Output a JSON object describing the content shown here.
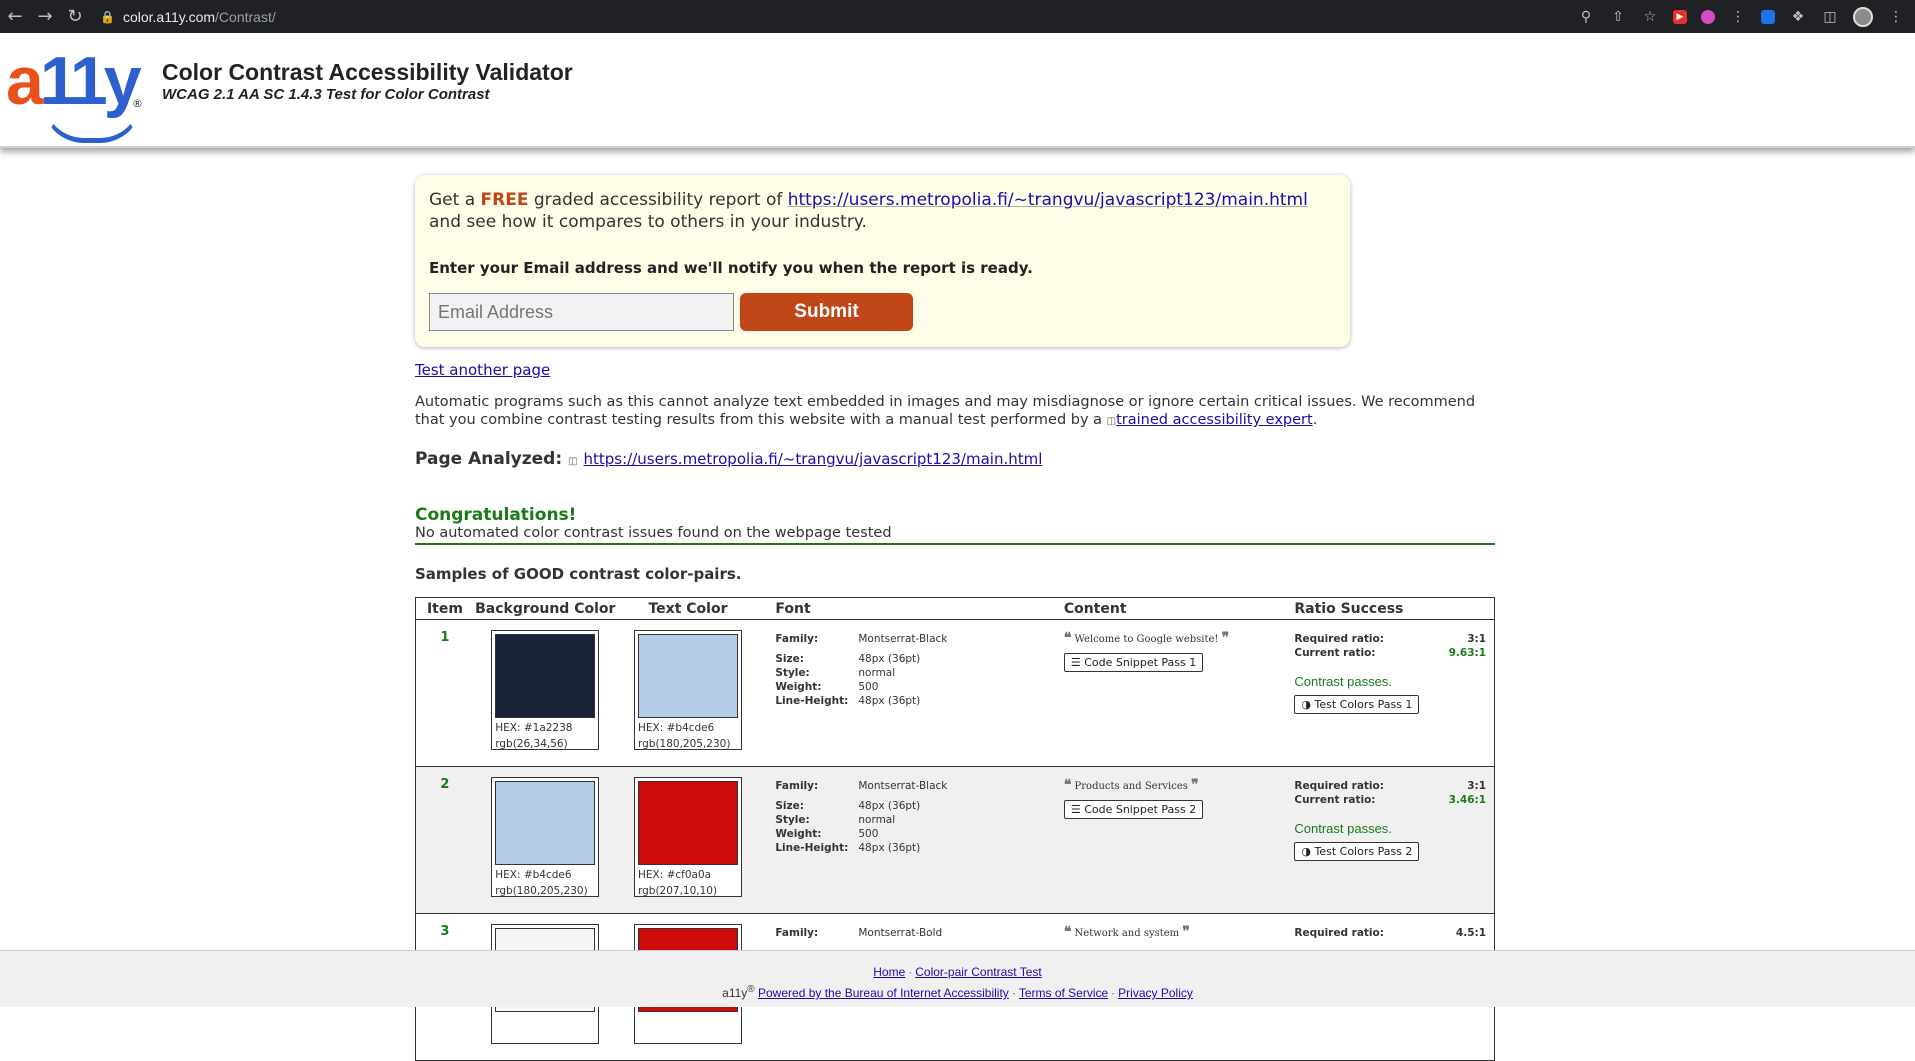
{
  "browser": {
    "url_host": "color.a11y.com",
    "url_path": "/Contrast/"
  },
  "header": {
    "logo_a": "a",
    "logo_11": "11",
    "logo_y": "y",
    "logo_reg": "®",
    "title": "Color Contrast Accessibility Validator",
    "subtitle": "WCAG 2.1 AA SC 1.4.3 Test for Color Contrast"
  },
  "promo": {
    "text_get": "Get a ",
    "free": "FREE",
    "text_graded": " graded accessibility report of ",
    "report_url": "https://users.metropolia.fi/~trangvu/javascript123/main.html",
    "text_compare": "and see how it compares to others in your industry.",
    "email_label": "Enter your Email address and we'll notify you when the report is ready.",
    "email_placeholder": "Email Address",
    "submit_label": "Submit"
  },
  "test_another": "Test another page",
  "disclaimer": {
    "text": "Automatic programs such as this cannot analyze text embedded in images and may misdiagnose or ignore certain critical issues. We recommend that you combine contrast testing results from this website with a manual test performed by a ",
    "link": "trained accessibility expert",
    "end": "."
  },
  "page_analyzed": {
    "label": "Page Analyzed:",
    "url": "https://users.metropolia.fi/~trangvu/javascript123/main.html"
  },
  "congrats": {
    "title": "Congratulations!",
    "text": "No automated color contrast issues found on the webpage tested"
  },
  "samples_title": "Samples of GOOD contrast color-pairs.",
  "table": {
    "headers": [
      "Item",
      "Background Color",
      "Text Color",
      "Font",
      "Content",
      "Ratio Success"
    ],
    "labels": {
      "family": "Family:",
      "size": "Size:",
      "style": "Style:",
      "weight": "Weight:",
      "line_height": "Line-Height:",
      "required": "Required ratio:",
      "current": "Current ratio:",
      "passes": "Contrast passes."
    },
    "rows": [
      {
        "num": "1",
        "bg_color": "#1a2238",
        "bg_hex": "HEX: #1a2238",
        "bg_rgb": "rgb(26,34,56)",
        "tc_color": "#b4cde6",
        "tc_hex": "HEX: #b4cde6",
        "tc_rgb": "rgb(180,205,230)",
        "family": "Montserrat-Black",
        "size": "48px (36pt)",
        "style": "normal",
        "weight": "500",
        "line_height": "48px (36pt)",
        "content": "Welcome to Google website!",
        "snippet": "Code Snippet Pass 1",
        "required": "3:1",
        "current": "9.63:1",
        "test_btn": "Test Colors Pass 1"
      },
      {
        "num": "2",
        "bg_color": "#b4cde6",
        "bg_hex": "HEX: #b4cde6",
        "bg_rgb": "rgb(180,205,230)",
        "tc_color": "#cf0a0a",
        "tc_hex": "HEX: #cf0a0a",
        "tc_rgb": "rgb(207,10,10)",
        "family": "Montserrat-Black",
        "size": "48px (36pt)",
        "style": "normal",
        "weight": "500",
        "line_height": "48px (36pt)",
        "content": "Products and Services",
        "snippet": "Code Snippet Pass 2",
        "required": "3:1",
        "current": "3.46:1",
        "test_btn": "Test Colors Pass 2"
      },
      {
        "num": "3",
        "bg_color": "#f5f5f5",
        "tc_color": "#cf0a0a",
        "family": "Montserrat-Bold",
        "content": "Network and system",
        "required": "4.5:1"
      }
    ]
  },
  "footer": {
    "home": "Home",
    "pair_test": "Color-pair Contrast Test",
    "brand": "a11y",
    "reg": "®",
    "powered": "Powered by the Bureau of Internet Accessibility",
    "tos": "Terms of Service",
    "privacy": "Privacy Policy"
  }
}
